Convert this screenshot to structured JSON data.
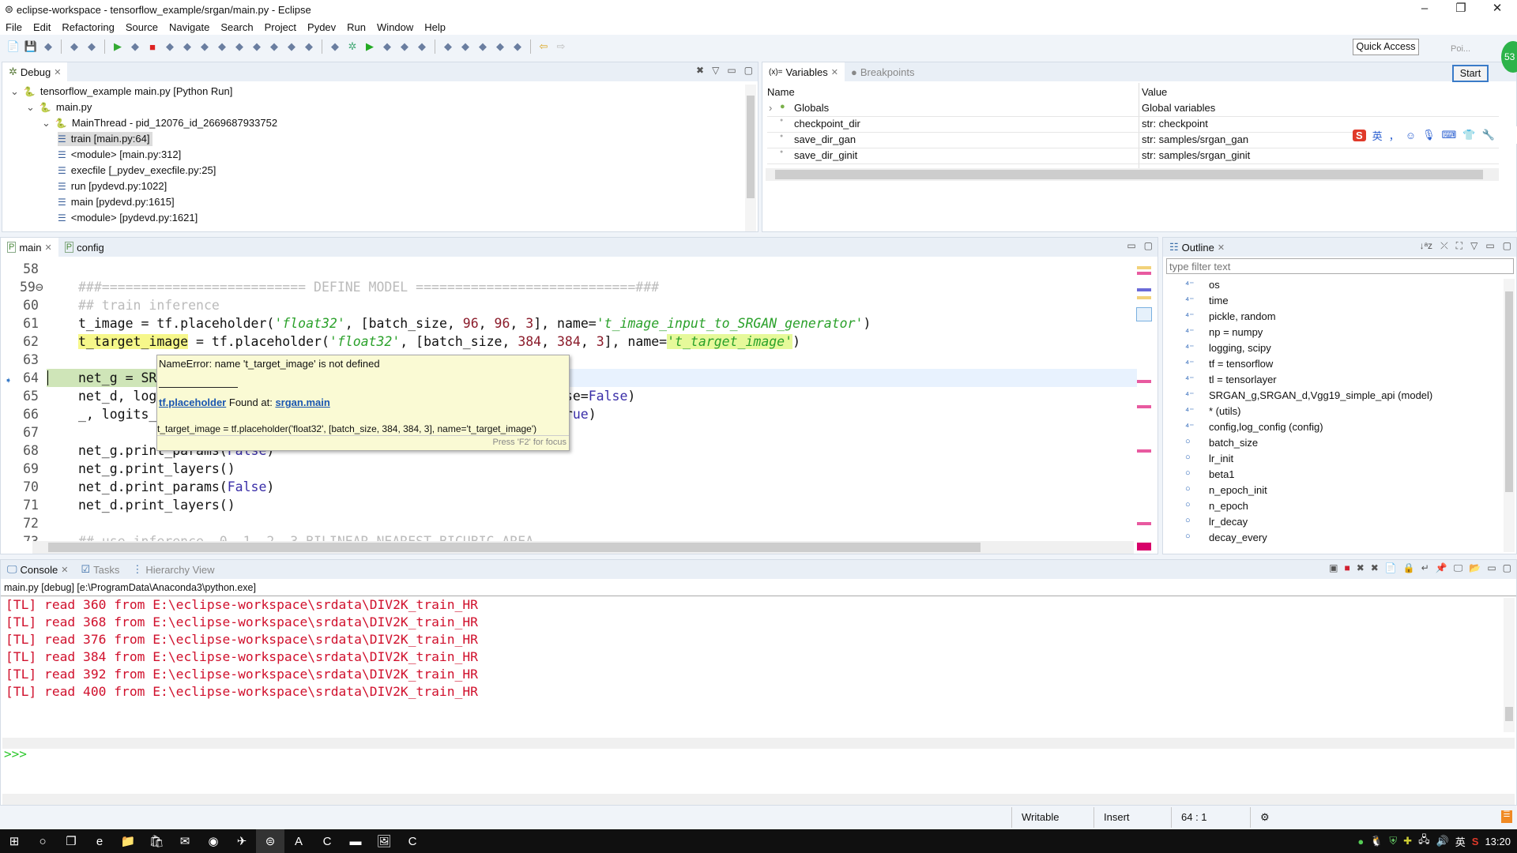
{
  "window": {
    "title": "eclipse-workspace - tensorflow_example/srgan/main.py - Eclipse",
    "minimize": "–",
    "restore": "❐",
    "close": "✕"
  },
  "menu": [
    "File",
    "Edit",
    "Refactoring",
    "Source",
    "Navigate",
    "Search",
    "Project",
    "Pydev",
    "Run",
    "Window",
    "Help"
  ],
  "toolbar": {
    "icons": [
      "new-icon",
      "save-icon",
      "save-all-icon",
      "profile-icon",
      "skip-breakpoints-icon",
      "resume-icon",
      "suspend-icon",
      "terminate-icon",
      "disconnect-icon",
      "step-into-icon",
      "step-over-icon",
      "step-return-icon",
      "drop-to-frame-icon",
      "use-step-filters-icon",
      "pydev-icon",
      "toggle-breakpoint-icon",
      "pydev-debug-icon",
      "open-type-icon",
      "debug-icon",
      "run-icon",
      "coverage-icon",
      "external-tools-icon",
      "open-project-icon",
      "open-folder-icon",
      "pin-icon",
      "next-annotation-icon",
      "previous-annotation-icon",
      "last-edit-icon",
      "back-icon",
      "forward-icon"
    ],
    "quick_access": "Quick Access",
    "perspective_tooltip": "Poi...",
    "start_button": "Start",
    "badge": "53"
  },
  "debug": {
    "tab": "Debug",
    "tree": [
      {
        "label": "tensorflow_example main.py [Python Run]",
        "level": 0,
        "icon": "python-run-icon"
      },
      {
        "label": "main.py",
        "level": 1,
        "icon": "python-process-icon"
      },
      {
        "label": "MainThread - pid_12076_id_2669687933752",
        "level": 2,
        "icon": "thread-icon"
      },
      {
        "label": "train [main.py:64]",
        "level": 3,
        "icon": "stack-frame-icon",
        "selected": true
      },
      {
        "label": "<module> [main.py:312]",
        "level": 3,
        "icon": "stack-frame-icon"
      },
      {
        "label": "execfile [_pydev_execfile.py:25]",
        "level": 3,
        "icon": "stack-frame-icon"
      },
      {
        "label": "run [pydevd.py:1022]",
        "level": 3,
        "icon": "stack-frame-icon"
      },
      {
        "label": "main [pydevd.py:1615]",
        "level": 3,
        "icon": "stack-frame-icon"
      },
      {
        "label": "<module> [pydevd.py:1621]",
        "level": 3,
        "icon": "stack-frame-icon"
      }
    ]
  },
  "variables": {
    "tab": "Variables",
    "tab2": "Breakpoints",
    "col_name": "Name",
    "col_value": "Value",
    "rows": [
      {
        "name": "Globals",
        "value": "Global variables",
        "expandable": true
      },
      {
        "name": "checkpoint_dir",
        "value": "str: checkpoint"
      },
      {
        "name": "save_dir_gan",
        "value": "str: samples/srgan_gan"
      },
      {
        "name": "save_dir_ginit",
        "value": "str: samples/srgan_ginit"
      }
    ]
  },
  "ime": {
    "logo": "S",
    "lang": "英",
    "punct": "，"
  },
  "editor": {
    "tabs": [
      {
        "label": "main",
        "active": true
      },
      {
        "label": "config",
        "active": false
      }
    ],
    "lines": [
      {
        "n": "58",
        "t": []
      },
      {
        "n": "59⊖",
        "t": [
          [
            "###========================== DEFINE MODEL ============================###",
            "com"
          ]
        ]
      },
      {
        "n": "60",
        "t": [
          [
            "## train inference",
            "com"
          ]
        ]
      },
      {
        "n": "61",
        "t": [
          [
            "t_image = tf.placeholder(",
            ""
          ],
          [
            "'float32'",
            "str"
          ],
          [
            ", [batch_size, ",
            ""
          ],
          [
            "96",
            "num"
          ],
          [
            ", ",
            ""
          ],
          [
            "96",
            "num"
          ],
          [
            ", ",
            ""
          ],
          [
            "3",
            "num"
          ],
          [
            "], name=",
            ""
          ],
          [
            "'t_image_input_to_SRGAN_generator'",
            "str"
          ],
          [
            ")",
            ""
          ]
        ]
      },
      {
        "n": "62",
        "t": [
          [
            "t_target_image",
            "hl"
          ],
          [
            " = tf.placeholder(",
            ""
          ],
          [
            "'float32'",
            "str"
          ],
          [
            ", [batch_size, ",
            ""
          ],
          [
            "384",
            "num"
          ],
          [
            ", ",
            ""
          ],
          [
            "384",
            "num"
          ],
          [
            ", ",
            ""
          ],
          [
            "3",
            "num"
          ],
          [
            "], name=",
            ""
          ],
          [
            "'t_target_image'",
            "strhl"
          ],
          [
            ")",
            ""
          ]
        ]
      },
      {
        "n": "63",
        "t": []
      },
      {
        "n": "64",
        "t": [
          [
            "net_g = SR",
            ""
          ]
        ],
        "current": true
      },
      {
        "n": "65",
        "t": [
          [
            "net_d, log                                                   use=",
            ""
          ],
          [
            "False",
            "bool"
          ],
          [
            ")",
            ""
          ]
        ]
      },
      {
        "n": "66",
        "t": [
          [
            "_, logits_                                                    r",
            ""
          ],
          [
            "ue",
            "bool"
          ],
          [
            ")",
            ""
          ]
        ]
      },
      {
        "n": "67",
        "t": []
      },
      {
        "n": "68",
        "t": [
          [
            "net_g.print_params(",
            ""
          ],
          [
            "False",
            "bool"
          ],
          [
            ")",
            ""
          ]
        ]
      },
      {
        "n": "69",
        "t": [
          [
            "net_g.print_layers()",
            ""
          ]
        ]
      },
      {
        "n": "70",
        "t": [
          [
            "net_d.print_params(",
            ""
          ],
          [
            "False",
            "bool"
          ],
          [
            ")",
            ""
          ]
        ]
      },
      {
        "n": "71",
        "t": [
          [
            "net_d.print_layers()",
            ""
          ]
        ]
      },
      {
        "n": "72",
        "t": []
      },
      {
        "n": "73",
        "t": [
          [
            "## use inference  0, 1, 2, 3 BILINEAR NEAREST BICUBIC AREA",
            "com"
          ]
        ]
      }
    ]
  },
  "tooltip": {
    "error": "NameError: name 't_target_image' is not defined",
    "link": "tf.placeholder",
    "found_at": "Found at:",
    "module": "srgan.main",
    "source": "t_target_image = tf.placeholder('float32', [batch_size, 384, 384, 3], name='t_target_image')",
    "hint": "Press 'F2' for focus"
  },
  "outline": {
    "tab": "Outline",
    "filter_placeholder": "type filter text",
    "items": [
      {
        "label": "os",
        "kind": "import"
      },
      {
        "label": "time",
        "kind": "import"
      },
      {
        "label": "pickle, random",
        "kind": "import"
      },
      {
        "label": "np = numpy",
        "kind": "import"
      },
      {
        "label": "logging, scipy",
        "kind": "import"
      },
      {
        "label": "tf = tensorflow",
        "kind": "import"
      },
      {
        "label": "tl = tensorlayer",
        "kind": "import"
      },
      {
        "label": "SRGAN_g,SRGAN_d,Vgg19_simple_api (model)",
        "kind": "import"
      },
      {
        "label": "* (utils)",
        "kind": "import"
      },
      {
        "label": "config,log_config (config)",
        "kind": "import"
      },
      {
        "label": "batch_size",
        "kind": "attr"
      },
      {
        "label": "lr_init",
        "kind": "attr"
      },
      {
        "label": "beta1",
        "kind": "attr"
      },
      {
        "label": "n_epoch_init",
        "kind": "attr"
      },
      {
        "label": "n_epoch",
        "kind": "attr"
      },
      {
        "label": "lr_decay",
        "kind": "attr"
      },
      {
        "label": "decay_every",
        "kind": "attr"
      }
    ]
  },
  "console": {
    "tabs": [
      "Console",
      "Tasks",
      "Hierarchy View"
    ],
    "header": "main.py [debug] [e:\\ProgramData\\Anaconda3\\python.exe]",
    "lines": [
      "[TL] read 360 from E:\\eclipse-workspace\\srdata\\DIV2K_train_HR",
      "[TL] read 368 from E:\\eclipse-workspace\\srdata\\DIV2K_train_HR",
      "[TL] read 376 from E:\\eclipse-workspace\\srdata\\DIV2K_train_HR",
      "[TL] read 384 from E:\\eclipse-workspace\\srdata\\DIV2K_train_HR",
      "[TL] read 392 from E:\\eclipse-workspace\\srdata\\DIV2K_train_HR",
      "[TL] read 400 from E:\\eclipse-workspace\\srdata\\DIV2K_train_HR"
    ],
    "prompt": ">>>"
  },
  "status": {
    "writable": "Writable",
    "mode": "Insert",
    "position": "64 : 1"
  },
  "taskbar": {
    "apps": [
      "windows-start-icon",
      "cortana-icon",
      "task-view-icon",
      "edge-icon",
      "file-explorer-icon",
      "store-icon",
      "mail-icon",
      "browser-icon",
      "app-icon",
      "eclipse-icon",
      "acrobat-icon",
      "camtasia-icon",
      "terminal-icon",
      "image-editor-icon",
      "recorder-icon"
    ],
    "lang": "英",
    "time": "13:20"
  },
  "colors": {
    "console_error": "#d0102c",
    "string": "#2ba12b",
    "number": "#8b1c2b",
    "keyword_const": "#3a2ea8",
    "occurrence_highlight": "#f6f78a",
    "current_debug_line": "#cfe5b8"
  }
}
